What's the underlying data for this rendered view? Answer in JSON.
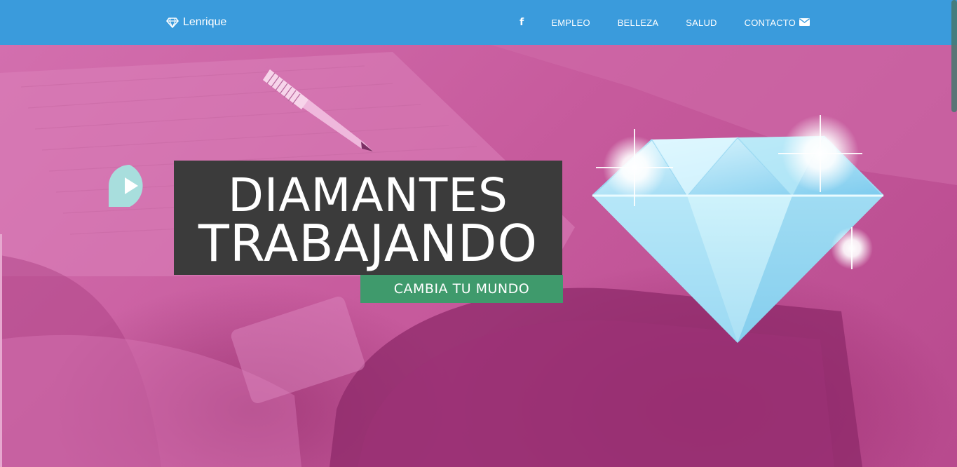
{
  "brand": {
    "name": "Lenrique",
    "icon": "diamond-icon"
  },
  "nav": {
    "facebook": {
      "label": "f",
      "icon": "facebook-icon"
    },
    "items": [
      {
        "label": "EMPLEO"
      },
      {
        "label": "BELLEZA"
      },
      {
        "label": "SALUD"
      },
      {
        "label": "CONTACTO",
        "icon": "envelope-icon"
      }
    ]
  },
  "hero": {
    "title_line1": "DIAMANTES",
    "title_line2": "TRABAJANDO",
    "subtitle": "CAMBIA TU MUNDO",
    "play_icon": "play-icon"
  },
  "colors": {
    "navbar": "#3a9bdc",
    "hero_tint": "#c65a9c",
    "title_box": "#3b3b3b",
    "subtitle_box": "#3f9a6c",
    "play_bubble": "#a8dedd"
  }
}
